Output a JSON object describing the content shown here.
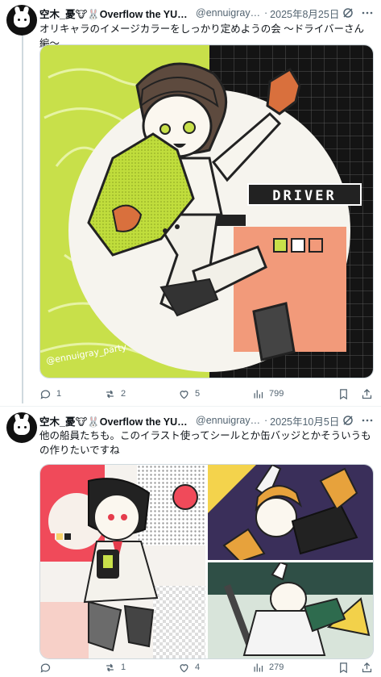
{
  "posts": [
    {
      "name": "空木_憂🐮🐰Overflow the YUnive",
      "handle": "@ennuigray_...",
      "separator": "·",
      "date": "2025年8月25日",
      "text": "オリキャラのイメージカラーをしっかり定めようの会 〜ドライバーさん編〜",
      "image_text": {
        "banner": "DRIVER",
        "signature": "@ennuigray_party"
      },
      "actions": {
        "replies": "1",
        "reposts": "2",
        "likes": "5",
        "views": "799"
      }
    },
    {
      "name": "空木_憂🐮🐰Overflow the YUnive",
      "handle": "@ennuigray_...",
      "separator": "·",
      "date": "2025年10月5日",
      "text": "他の船員たちも。このイラスト使ってシールとか缶バッジとかそういうもの作りたいですね",
      "actions": {
        "replies": "",
        "reposts": "1",
        "likes": "4",
        "views": "279"
      }
    }
  ],
  "colors": {
    "lime": "#c8e04a",
    "salmon": "#f29a7a",
    "text_secondary": "#536471",
    "accent": "#1d9bf0"
  },
  "icons": [
    "avatar",
    "verified-badge",
    "grok-icon",
    "more-icon",
    "reply-icon",
    "repost-icon",
    "like-icon",
    "views-icon",
    "bookmark-icon",
    "share-icon"
  ]
}
